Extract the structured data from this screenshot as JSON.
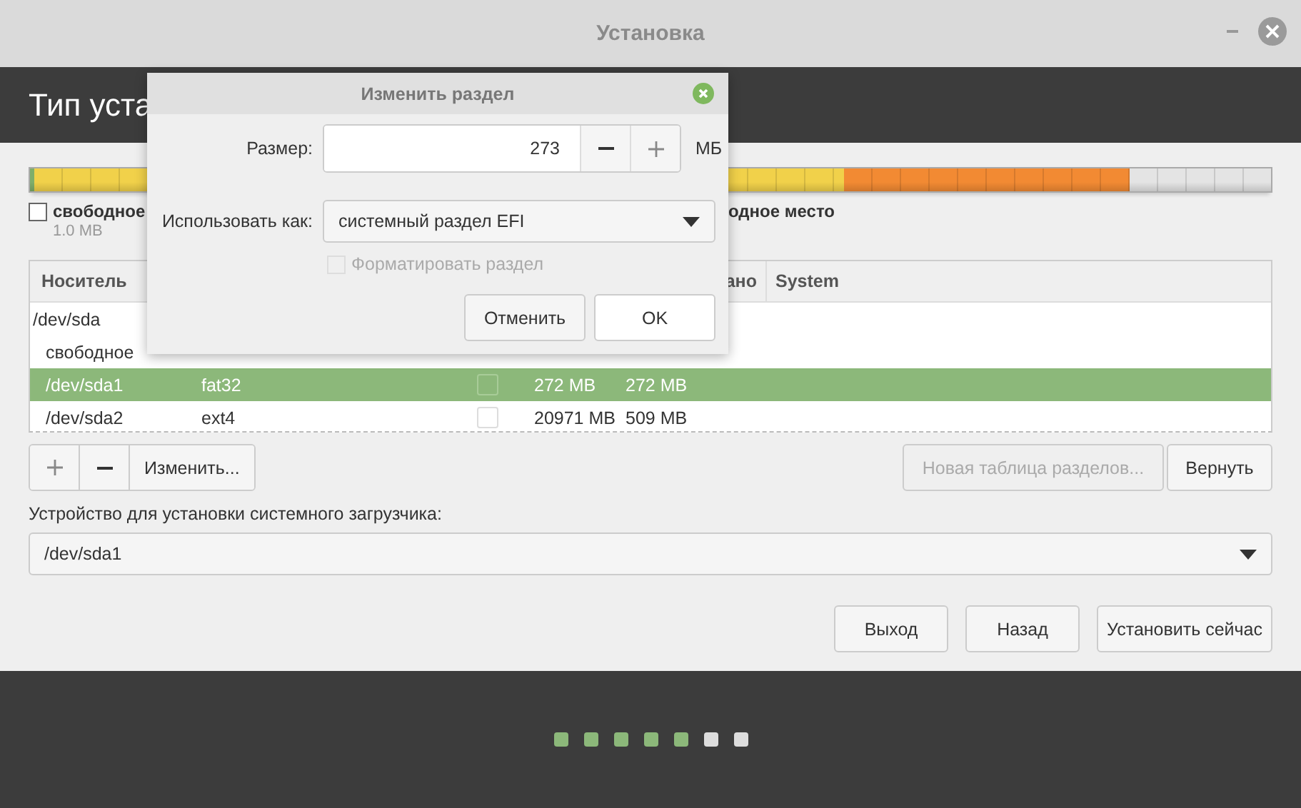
{
  "window": {
    "title": "Установка"
  },
  "header": {
    "title": "Тип уста"
  },
  "partition_bar": {
    "segments": [
      {
        "color": "#7fae6a"
      },
      {
        "color": "#f1d14a"
      },
      {
        "color": "#f28a33"
      },
      {
        "color": "#e4e4e4"
      }
    ]
  },
  "legend": [
    {
      "label": "свободное",
      "size": "1.0 MB",
      "checked": false
    },
    {
      "label": "одное место"
    }
  ],
  "table": {
    "columns": [
      "Носитель",
      "ано",
      "System"
    ],
    "rows": [
      {
        "kind": "disk",
        "cells": [
          "/dev/sda"
        ],
        "selected": false
      },
      {
        "kind": "free",
        "cells": [
          "свободное"
        ],
        "selected": false
      },
      {
        "kind": "partition",
        "cells": [
          "/dev/sda1",
          "fat32",
          "272 MB",
          "272 MB"
        ],
        "format": false,
        "selected": true
      },
      {
        "kind": "partition",
        "cells": [
          "/dev/sda2",
          "ext4",
          "20971 MB",
          "509 MB"
        ],
        "format": false,
        "selected": false
      }
    ]
  },
  "table_toolbar": {
    "edit_label": "Изменить...",
    "new_table": {
      "label": "Новая таблица разделов...",
      "disabled": true
    },
    "revert": {
      "label": "Вернуть",
      "disabled": false
    }
  },
  "bootloader": {
    "label": "Устройство для установки системного загрузчика:",
    "value": "/dev/sda1"
  },
  "buttons": [
    "Выход",
    "Назад",
    "Установить сейчас"
  ],
  "steps": [
    {
      "done": true
    },
    {
      "done": true
    },
    {
      "done": true
    },
    {
      "done": true
    },
    {
      "done": true
    },
    {
      "done": false
    },
    {
      "done": false
    }
  ],
  "dialog": {
    "title": "Изменить раздел",
    "size_label": "Размер:",
    "size_value": "273",
    "unit": "МБ",
    "use_label": "Использовать как:",
    "use_value": "системный раздел EFI",
    "format": {
      "label": "Форматировать раздел",
      "checked": false,
      "disabled": true
    },
    "buttons": [
      "Отменить",
      "OK"
    ]
  }
}
